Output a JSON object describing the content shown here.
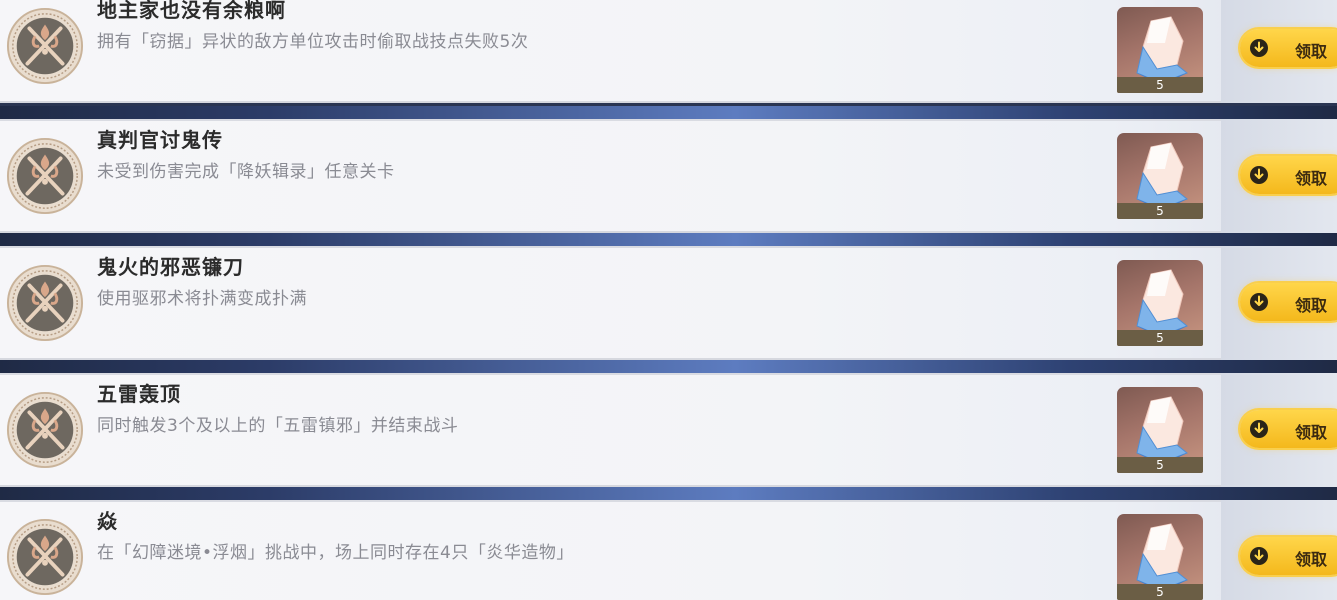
{
  "achievements": [
    {
      "title": "地主家也没有余粮啊",
      "description": "拥有「窃据」异状的敌方单位攻击时偷取战技点失败5次",
      "reward_count": "5",
      "claim_label": "领取"
    },
    {
      "title": "真判官讨鬼传",
      "description": "未受到伤害完成「降妖辑录」任意关卡",
      "reward_count": "5",
      "claim_label": "领取"
    },
    {
      "title": "鬼火的邪恶镰刀",
      "description": "使用驱邪术将扑满变成扑满",
      "reward_count": "5",
      "claim_label": "领取"
    },
    {
      "title": "五雷轰顶",
      "description": "同时触发3个及以上的「五雷镇邪」并结束战斗",
      "reward_count": "5",
      "claim_label": "领取"
    },
    {
      "title": "焱",
      "description": "在「幻障迷境•浮烟」挑战中，场上同时存在4只「炎华造物」",
      "reward_count": "5",
      "claim_label": "领取"
    }
  ],
  "icons": {
    "badge": "achievement-emblem-icon",
    "reward": "stellar-jade-icon",
    "claim": "download-arrow-icon"
  },
  "colors": {
    "claim_button": "#f7c22d",
    "separator": "#2c3c68",
    "title_text": "#2b2b2b",
    "description_text": "#8a8b93"
  }
}
